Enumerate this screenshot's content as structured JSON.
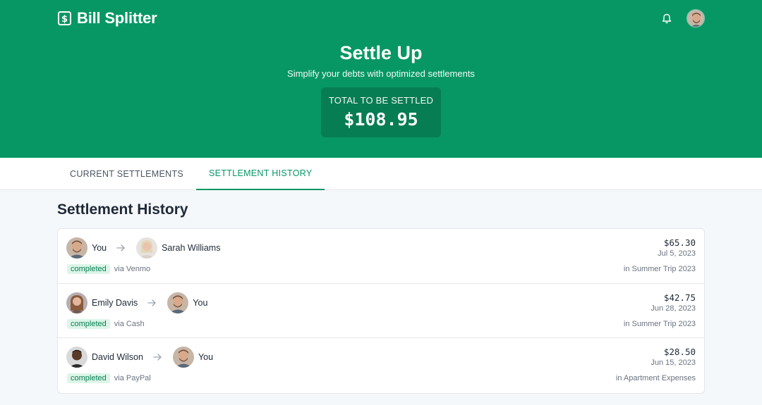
{
  "app": {
    "name": "Bill Splitter"
  },
  "colors": {
    "primary": "#079764",
    "primary_dark": "#077d53",
    "badge_bg": "#dcf5e8"
  },
  "icons": {
    "brand": "dollar-bill-icon",
    "notifications": "bell-icon",
    "arrow": "arrow-right-icon"
  },
  "hero": {
    "title": "Settle Up",
    "subtitle": "Simplify your debts with optimized settlements",
    "total_label": "TOTAL TO BE SETTLED",
    "total_value": "$108.95"
  },
  "tabs": [
    {
      "label": "CURRENT SETTLEMENTS",
      "active": false
    },
    {
      "label": "SETTLEMENT HISTORY",
      "active": true
    }
  ],
  "history": {
    "title": "Settlement History",
    "items": [
      {
        "from": "You",
        "to": "Sarah Williams",
        "status": "completed",
        "method": "via Venmo",
        "amount": "$65.30",
        "date": "Jul 5, 2023",
        "group": "in Summer Trip 2023"
      },
      {
        "from": "Emily Davis",
        "to": "You",
        "status": "completed",
        "method": "via Cash",
        "amount": "$42.75",
        "date": "Jun 28, 2023",
        "group": "in Summer Trip 2023"
      },
      {
        "from": "David Wilson",
        "to": "You",
        "status": "completed",
        "method": "via PayPal",
        "amount": "$28.50",
        "date": "Jun 15, 2023",
        "group": "in Apartment Expenses"
      }
    ]
  }
}
